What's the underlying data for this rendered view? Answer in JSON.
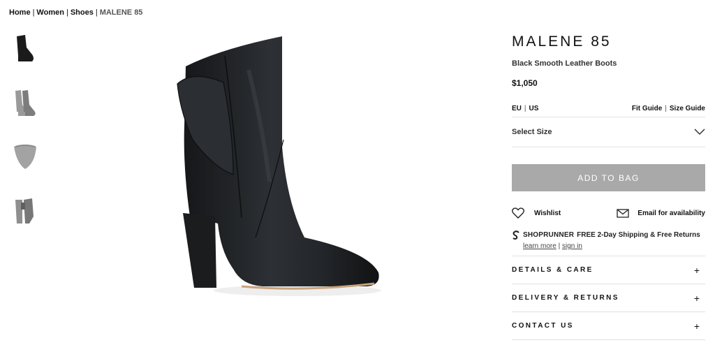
{
  "breadcrumb": {
    "items": [
      "Home",
      "Women",
      "Shoes"
    ],
    "separator": "|",
    "current": "MALENE 85"
  },
  "thumbnails": [
    {
      "icon": "boot-side-icon",
      "alt": ""
    },
    {
      "icon": "boot-pair-icon",
      "alt": ""
    },
    {
      "icon": "boot-sole-icon",
      "alt": ""
    },
    {
      "icon": "boot-back-icon",
      "alt": ""
    }
  ],
  "product": {
    "title": "MALENE 85",
    "subtitle": "Black Smooth Leather Boots",
    "price": "$1,050",
    "size_units": {
      "eu": "EU",
      "us": "US"
    },
    "fit_guide": "Fit Guide",
    "size_guide": "Size Guide",
    "select_size": "Select Size",
    "add_to_bag": "ADD TO BAG",
    "wishlist": "Wishlist",
    "email_availability": "Email for availability"
  },
  "shoprunner": {
    "logo": "SHOPRUNNER",
    "offer": "FREE 2-Day Shipping & Free Returns",
    "learn_more": "learn more",
    "sign_in": "sign in"
  },
  "accordion": [
    {
      "label": "DETAILS & CARE"
    },
    {
      "label": "DELIVERY & RETURNS"
    },
    {
      "label": "CONTACT US"
    }
  ],
  "colors": {
    "add_to_bag_bg": "#a9a9a9",
    "divider": "#e1e1e1",
    "text": "#111111"
  }
}
